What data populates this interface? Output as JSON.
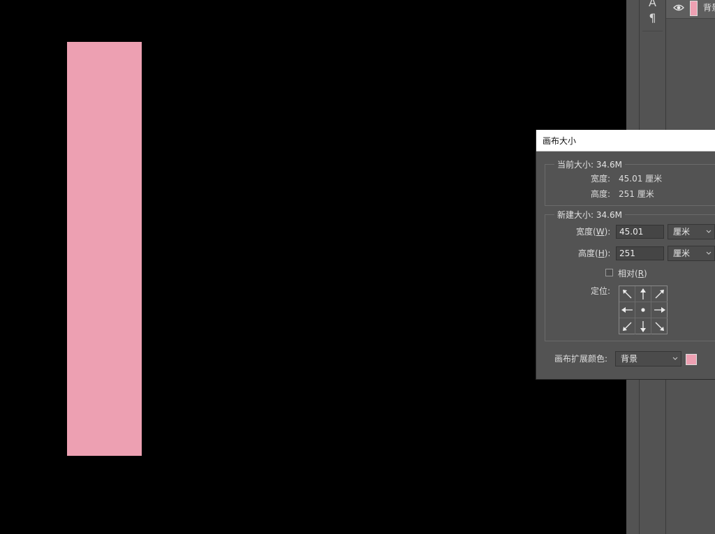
{
  "dialog": {
    "title": "画布大小",
    "current_size": {
      "label": "当前大小: 34.6M",
      "width_label": "宽度:",
      "width_value": "45.01 厘米",
      "height_label": "高度:",
      "height_value": "251 厘米"
    },
    "new_size": {
      "label": "新建大小: 34.6M",
      "width_label": "宽度(",
      "width_key": "W",
      "width_close": "):",
      "width_value": "45.01",
      "width_unit": "厘米",
      "height_label": "高度(",
      "height_key": "H",
      "height_close": "):",
      "height_value": "251",
      "height_unit": "厘米",
      "relative_label": "相对(",
      "relative_key": "R",
      "relative_close": ")",
      "relative_checked": false,
      "anchor_label": "定位:"
    },
    "extension_color_label": "画布扩展颜色:",
    "extension_color_value": "背景",
    "extension_color_swatch": "#eda0b2"
  },
  "layers": {
    "layer_name": "背景"
  },
  "tools": {
    "type_glyph": "A",
    "paragraph_glyph": "¶"
  },
  "icons": {
    "eye": "eye-icon",
    "chevron": "chevron-down-icon",
    "arrows": [
      "arrow-nw-icon",
      "arrow-n-icon",
      "arrow-ne-icon",
      "arrow-w-icon",
      "anchor-center-icon",
      "arrow-e-icon",
      "arrow-sw-icon",
      "arrow-s-icon",
      "arrow-se-icon"
    ]
  },
  "colors": {
    "canvas_background": "#000000",
    "canvas_fill": "#eda0b2",
    "panel": "#535353"
  }
}
